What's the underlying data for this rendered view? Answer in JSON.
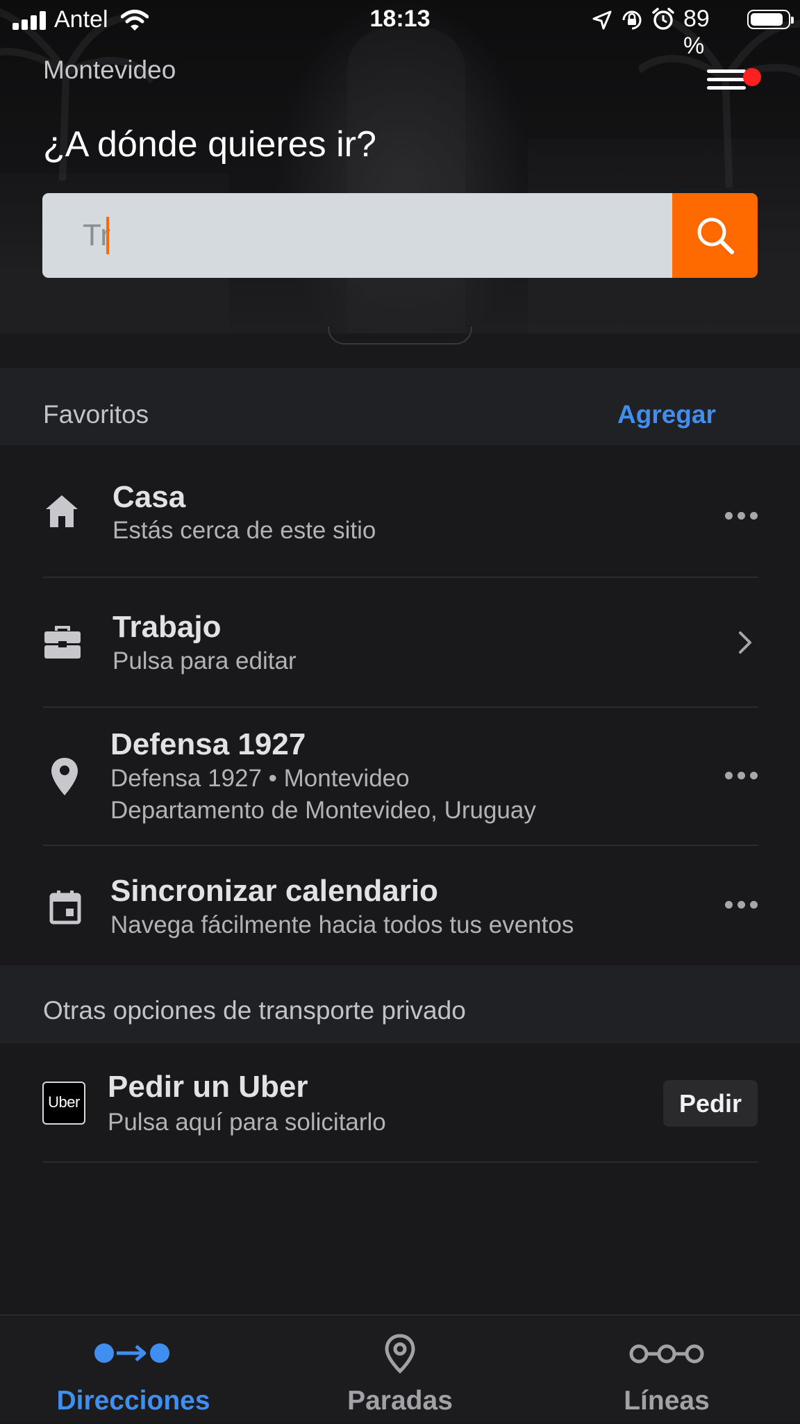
{
  "status_bar": {
    "carrier": "Antel",
    "time": "18:13",
    "battery_percent": "89 %",
    "battery_level": 0.89,
    "icons": [
      "signal-icon",
      "wifi-icon",
      "location-arrow-icon",
      "rotation-lock-icon",
      "alarm-icon",
      "battery-icon"
    ]
  },
  "header": {
    "city": "Montevideo",
    "question": "¿A dónde quieres ir?",
    "menu_icon": "hamburger-menu-icon",
    "notification_dot_color": "#ff2020"
  },
  "search": {
    "value": "Tr",
    "placeholder": "",
    "button_icon": "search-icon",
    "accent_color": "#ff6a00"
  },
  "favorites": {
    "title": "Favoritos",
    "add_label": "Agregar",
    "items": [
      {
        "icon": "home-icon",
        "title": "Casa",
        "subtitle": "Estás cerca de este sitio",
        "action": "more-icon"
      },
      {
        "icon": "briefcase-icon",
        "title": "Trabajo",
        "subtitle": "Pulsa para editar",
        "action": "chevron-right-icon"
      },
      {
        "icon": "location-pin-icon",
        "title": "Defensa 1927",
        "subtitle": "Defensa 1927 • Montevideo",
        "subtitle2": "Departamento de Montevideo, Uruguay",
        "action": "more-icon"
      },
      {
        "icon": "calendar-icon",
        "title": "Sincronizar calendario",
        "subtitle": "Navega fácilmente hacia todos tus eventos",
        "action": "more-icon"
      }
    ]
  },
  "transport": {
    "title": "Otras opciones de transporte privado",
    "uber": {
      "logo_text": "Uber",
      "title": "Pedir un Uber",
      "subtitle": "Pulsa aquí para solicitarlo",
      "button_label": "Pedir"
    }
  },
  "tabs": [
    {
      "label": "Direcciones",
      "icon": "directions-icon",
      "active": true
    },
    {
      "label": "Paradas",
      "icon": "stop-pin-icon",
      "active": false
    },
    {
      "label": "Líneas",
      "icon": "lines-icon",
      "active": false
    }
  ],
  "colors": {
    "link_blue": "#3f8ef0",
    "background": "#19191b",
    "section_background": "#202124"
  }
}
